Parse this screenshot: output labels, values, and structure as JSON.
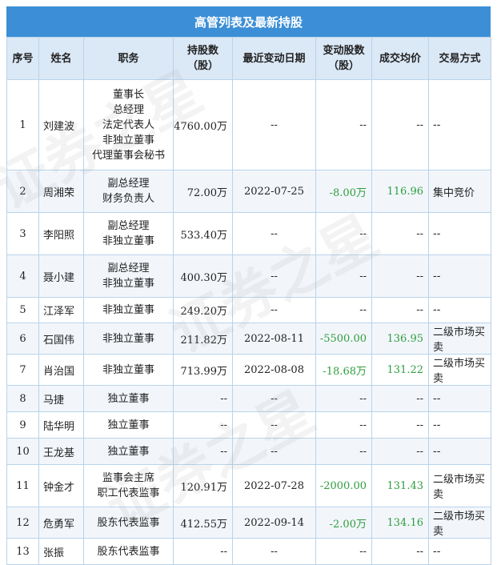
{
  "title": "高管列表及最新持股",
  "headers": {
    "no": "序号",
    "name": "姓名",
    "position": "职务",
    "holding_line1": "持股数",
    "holding_line2": "（股）",
    "date": "最近变动日期",
    "change_line1": "变动股数",
    "change_line2": "（股）",
    "price": "成交均价",
    "method": "交易方式"
  },
  "watermark": "证券之星",
  "colors": {
    "header_bar": "#3c8fd6",
    "header_row": "#dbe8f6",
    "positive_green": "#2e9e3e"
  },
  "rows": [
    {
      "no": "1",
      "name": "刘建波",
      "positions": [
        "董事长",
        "总经理",
        "法定代表人",
        "非独立董事",
        "代理董事会秘书"
      ],
      "holding_num": "4760.00",
      "holding_unit": "万",
      "date": "--",
      "change_num": "--",
      "change_unit": "",
      "price": "--",
      "method": "--"
    },
    {
      "no": "2",
      "name": "周湘荣",
      "positions": [
        "副总经理",
        "财务负责人"
      ],
      "holding_num": "72.00",
      "holding_unit": "万",
      "date": "2022-07-25",
      "change_num": "-8.00",
      "change_unit": "万",
      "price": "116.96",
      "method": "集中竞价"
    },
    {
      "no": "3",
      "name": "李阳照",
      "positions": [
        "副总经理",
        "非独立董事"
      ],
      "holding_num": "533.40",
      "holding_unit": "万",
      "date": "--",
      "change_num": "--",
      "change_unit": "",
      "price": "--",
      "method": "--"
    },
    {
      "no": "4",
      "name": "聂小建",
      "positions": [
        "副总经理",
        "非独立董事"
      ],
      "holding_num": "400.30",
      "holding_unit": "万",
      "date": "--",
      "change_num": "--",
      "change_unit": "",
      "price": "--",
      "method": "--"
    },
    {
      "no": "5",
      "name": "江泽军",
      "positions": [
        "非独立董事"
      ],
      "holding_num": "249.20",
      "holding_unit": "万",
      "date": "--",
      "change_num": "--",
      "change_unit": "",
      "price": "--",
      "method": "--"
    },
    {
      "no": "6",
      "name": "石国伟",
      "positions": [
        "非独立董事"
      ],
      "holding_num": "211.82",
      "holding_unit": "万",
      "date": "2022-08-11",
      "change_num": "-5500.00",
      "change_unit": "",
      "price": "136.95",
      "method": "二级市场买卖"
    },
    {
      "no": "7",
      "name": "肖治国",
      "positions": [
        "非独立董事"
      ],
      "holding_num": "713.99",
      "holding_unit": "万",
      "date": "2022-08-08",
      "change_num": "-18.68",
      "change_unit": "万",
      "price": "131.22",
      "method": "二级市场买卖"
    },
    {
      "no": "8",
      "name": "马捷",
      "positions": [
        "独立董事"
      ],
      "holding_num": "--",
      "holding_unit": "",
      "date": "--",
      "change_num": "--",
      "change_unit": "",
      "price": "--",
      "method": "--"
    },
    {
      "no": "9",
      "name": "陆华明",
      "positions": [
        "独立董事"
      ],
      "holding_num": "--",
      "holding_unit": "",
      "date": "--",
      "change_num": "--",
      "change_unit": "",
      "price": "--",
      "method": "--"
    },
    {
      "no": "10",
      "name": "王龙基",
      "positions": [
        "独立董事"
      ],
      "holding_num": "--",
      "holding_unit": "",
      "date": "--",
      "change_num": "--",
      "change_unit": "",
      "price": "--",
      "method": "--"
    },
    {
      "no": "11",
      "name": "钟金才",
      "positions": [
        "监事会主席",
        "职工代表监事"
      ],
      "holding_num": "120.91",
      "holding_unit": "万",
      "date": "2022-07-28",
      "change_num": "-2000.00",
      "change_unit": "",
      "price": "131.43",
      "method": "二级市场买卖"
    },
    {
      "no": "12",
      "name": "危勇军",
      "positions": [
        "股东代表监事"
      ],
      "holding_num": "412.55",
      "holding_unit": "万",
      "date": "2022-09-14",
      "change_num": "-2.00",
      "change_unit": "万",
      "price": "134.16",
      "method": "二级市场买卖"
    },
    {
      "no": "13",
      "name": "张振",
      "positions": [
        "股东代表监事"
      ],
      "holding_num": "--",
      "holding_unit": "",
      "date": "--",
      "change_num": "--",
      "change_unit": "",
      "price": "--",
      "method": "--"
    }
  ]
}
